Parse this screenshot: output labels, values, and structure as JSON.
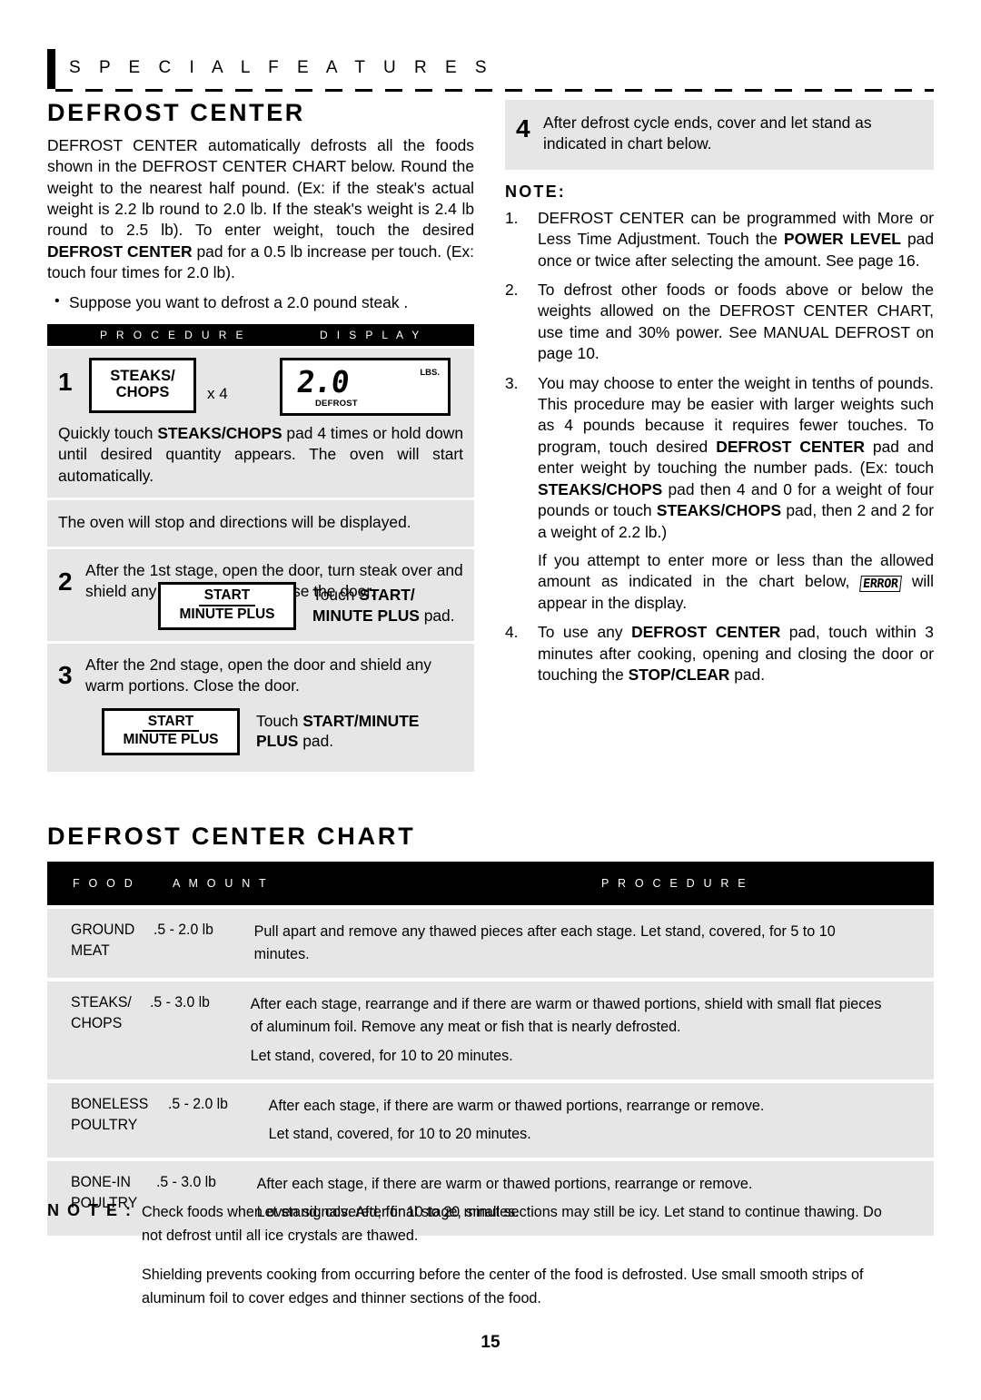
{
  "header": {
    "bar_label": "S P E C I A L   F E A T U R E S"
  },
  "page_number": "15",
  "left": {
    "section_title": "DEFROST CENTER",
    "intro_paragraph_1": "DEFROST CENTER automatically defrosts all the foods shown in the DEFROST CENTER CHART below. Round the weight to the nearest half pound. (Ex: if the steak's actual weight is 2.2 lb round to 2.0 lb. If the steak's weight is 2.4 lb round to 2.5 lb). To enter weight, touch the desired ",
    "intro_bold_1": "DEFROST CENTER",
    "intro_paragraph_1b": " pad for a 0.5 lb increase per touch. (Ex: touch four times for 2.0 lb).",
    "bullet_1": "Suppose you want to defrost a 2.0 pound steak .",
    "table_header_procedure": "P R O C E D U R E",
    "table_header_display": "D I S P L A Y",
    "step1": {
      "number": "1",
      "pad_line1": "STEAKS/",
      "pad_line2": "CHOPS",
      "multiplier": "x 4",
      "lcd_value": "2.0",
      "lcd_units": "LBS.",
      "lcd_mode": "DEFROST",
      "text_a": "Quickly touch ",
      "text_bold": "STEAKS/CHOPS",
      "text_b": " pad 4 times or hold down until desired quantity appears. The oven will start automatically."
    },
    "interstitial": "The oven will stop and directions will be displayed.",
    "step2": {
      "number": "2",
      "text": "After the 1st stage, open the door, turn steak over and shield any warm portions. Close the door.",
      "pad_line1": "START",
      "pad_line2": "MINUTE PLUS",
      "touch_a": "Touch ",
      "touch_bold1": "START/",
      "touch_bold2": "MINUTE PLUS",
      "touch_b": " pad."
    },
    "step3": {
      "number": "3",
      "text": "After the 2nd stage, open the door and shield any warm portions. Close the door.",
      "pad_line1": "START",
      "pad_line2": "MINUTE PLUS",
      "touch_a": "Touch ",
      "touch_bold1": "START/MINUTE",
      "touch_bold2": "PLUS",
      "touch_b": " pad."
    }
  },
  "right": {
    "step4": {
      "number": "4",
      "text": "After defrost cycle ends, cover and let stand as indicated in chart below."
    },
    "note_heading": "NOTE:",
    "notes": [
      {
        "number": "1.",
        "part_a": "DEFROST CENTER can be programmed with More or Less Time Adjustment. Touch the ",
        "bold_1": "POWER LEVEL",
        "part_b": " pad once or twice after selecting the amount. See page 16."
      },
      {
        "number": "2.",
        "part_a": "To defrost other foods or foods above or below the weights allowed on the DEFROST CENTER CHART, use time and 30% power. See MANUAL DEFROST on page 10.",
        "bold_1": "",
        "part_b": ""
      },
      {
        "number": "3.",
        "part_a": "You may choose to enter the weight in tenths of pounds. This procedure may be easier with larger weights such as 4 pounds because it requires fewer touches. To program, touch desired ",
        "bold_1": "DEFROST CENTER",
        "part_b": " pad and enter weight by touching the number pads. (Ex: touch ",
        "bold_2": "STEAKS/CHOPS",
        "part_c": " pad then 4  and 0  for a weight of four pounds or touch ",
        "bold_3": "STEAKS/CHOPS",
        "part_d": " pad, then 2  and 2  for a weight of 2.2 lb.)",
        "para2_a": "If you attempt to enter more or less than the allowed amount as indicated in the chart below, ",
        "para2_lcd": "ERROR",
        "para2_b": " will appear in the display."
      },
      {
        "number": "4.",
        "part_a": "To use any ",
        "bold_1": "DEFROST CENTER",
        "part_b": " pad, touch within 3 minutes after cooking, opening and closing the door or touching the ",
        "bold_2": "STOP/CLEAR",
        "part_c": " pad."
      }
    ]
  },
  "chart": {
    "title": "DEFROST CENTER CHART",
    "headers": {
      "food": "F O O D",
      "amount": "A M O U N T",
      "procedure": "P R O C E D U R E"
    },
    "rows": [
      {
        "food_line1": "GROUND",
        "food_line2": "MEAT",
        "amount": ".5 - 2.0 lb",
        "procedure_paragraphs": [
          "Pull apart and remove any thawed pieces after each stage. Let stand, covered, for 5 to 10 minutes."
        ]
      },
      {
        "food_line1": "STEAKS/",
        "food_line2": "CHOPS",
        "amount": ".5 - 3.0 lb",
        "procedure_paragraphs": [
          "After each stage, rearrange and if there are warm or thawed portions, shield with small flat pieces of aluminum foil. Remove any meat or fish that is nearly defrosted.",
          "Let stand, covered, for 10 to 20 minutes."
        ]
      },
      {
        "food_line1": "BONELESS",
        "food_line2": "POULTRY",
        "amount": ".5 - 2.0 lb",
        "procedure_paragraphs": [
          "After each stage, if there are warm or thawed portions, rearrange or remove.",
          "Let stand, covered, for 10 to 20 minutes."
        ]
      },
      {
        "food_line1": "BONE-IN",
        "food_line2": "POULTRY",
        "amount": ".5 - 3.0 lb",
        "procedure_paragraphs": [
          "After each stage, if there are warm or thawed portions, rearrange or remove.",
          "Let stand, covered, for 10 to 20 minutes."
        ]
      }
    ]
  },
  "bottom_note": {
    "label": "N O T E :",
    "paragraph_1": "Check foods when oven signals. After final stage, small sections may still be icy. Let stand to continue thawing. Do not defrost until all ice crystals are thawed.",
    "paragraph_2": "Shielding prevents cooking from occurring before the center of the food is defrosted. Use small smooth strips of aluminum foil to cover edges and thinner sections of the food."
  }
}
